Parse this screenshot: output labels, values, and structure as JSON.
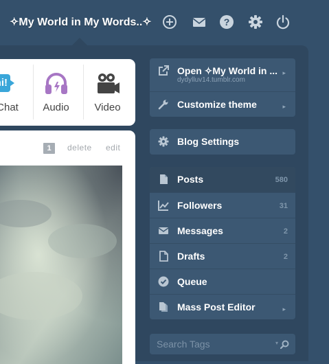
{
  "header": {
    "blog_title": "✧My World in My Words..✧",
    "icons": [
      "plus-circle-icon",
      "mail-icon",
      "help-icon",
      "gear-icon",
      "power-icon"
    ]
  },
  "post_types": [
    {
      "label": "Chat",
      "icon": "chat-bubble-icon",
      "bubble_text": "hi!",
      "color": "#3aa6d9"
    },
    {
      "label": "Audio",
      "icon": "headphones-icon",
      "color": "#a776c4"
    },
    {
      "label": "Video",
      "icon": "video-camera-icon",
      "color": "#444444"
    }
  ],
  "post": {
    "note_count": "1",
    "delete_label": "delete",
    "edit_label": "edit"
  },
  "sidebar": {
    "blog_box": [
      {
        "label": "Open ✧My World in ...",
        "sub": "dydylluv14.tumblr.com",
        "icon": "external-link-icon"
      },
      {
        "label": "Customize theme",
        "icon": "wrench-icon"
      }
    ],
    "settings": {
      "label": "Blog Settings",
      "icon": "gear-icon"
    },
    "nav": [
      {
        "label": "Posts",
        "count": "580",
        "icon": "document-icon"
      },
      {
        "label": "Followers",
        "count": "31",
        "icon": "chart-icon"
      },
      {
        "label": "Messages",
        "count": "2",
        "icon": "mail-icon"
      },
      {
        "label": "Drafts",
        "count": "2",
        "icon": "document-icon"
      },
      {
        "label": "Queue",
        "count": "",
        "icon": "check-circle-icon"
      },
      {
        "label": "Mass Post Editor",
        "count": "",
        "icon": "document-stack-icon"
      }
    ],
    "search": {
      "placeholder": "Search Tags"
    }
  },
  "colors": {
    "background": "#34506b",
    "panel": "#2f475f",
    "sidebar_box": "#3c5873",
    "chat_blue": "#3aa6d9",
    "audio_purple": "#a776c4"
  }
}
